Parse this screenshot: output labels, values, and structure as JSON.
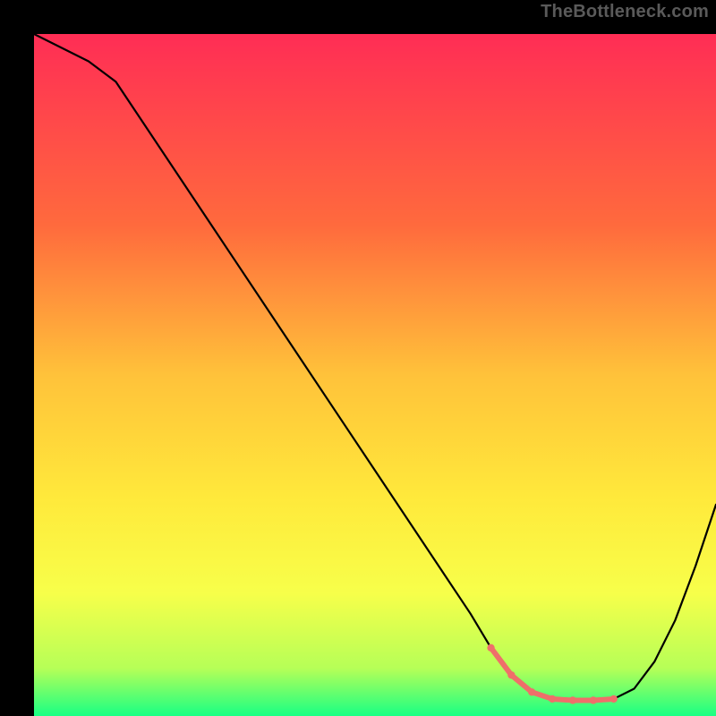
{
  "watermark": "TheBottleneck.com",
  "chart_data": {
    "type": "line",
    "title": "",
    "xlabel": "",
    "ylabel": "",
    "xlim": [
      0,
      100
    ],
    "ylim": [
      0,
      100
    ],
    "gradient_stops": [
      {
        "offset": 0,
        "color": "#ff2d55"
      },
      {
        "offset": 0.28,
        "color": "#ff6a3d"
      },
      {
        "offset": 0.5,
        "color": "#ffc23a"
      },
      {
        "offset": 0.68,
        "color": "#ffe93b"
      },
      {
        "offset": 0.82,
        "color": "#f7ff4a"
      },
      {
        "offset": 0.93,
        "color": "#b6ff57"
      },
      {
        "offset": 1.0,
        "color": "#19ff84"
      }
    ],
    "series": [
      {
        "name": "bottleneck-curve",
        "color": "#000000",
        "width": 2.2,
        "x": [
          0,
          4,
          8,
          12,
          60,
          64,
          67,
          70,
          73,
          76,
          79,
          82,
          85,
          88,
          91,
          94,
          97,
          100
        ],
        "values": [
          100,
          98,
          96,
          93,
          21,
          15,
          10,
          6,
          3.5,
          2.5,
          2.3,
          2.3,
          2.5,
          4,
          8,
          14,
          22,
          31
        ]
      },
      {
        "name": "highlight-segment",
        "color": "#ef6f6a",
        "width": 6,
        "x": [
          67,
          70,
          73,
          76,
          79,
          82,
          85
        ],
        "values": [
          10,
          6,
          3.5,
          2.5,
          2.3,
          2.3,
          2.5
        ],
        "dots_x": [
          67,
          70,
          73,
          76,
          79,
          82,
          85
        ],
        "dots_y": [
          10,
          6,
          3.5,
          2.5,
          2.3,
          2.3,
          2.5
        ]
      }
    ]
  }
}
